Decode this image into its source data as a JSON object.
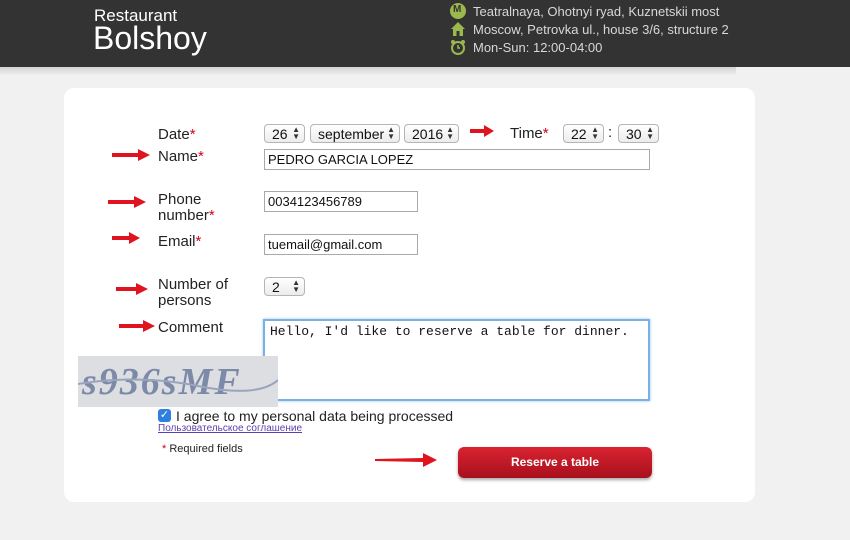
{
  "header": {
    "brand_small": "Restaurant",
    "brand_big": "Bolshoy",
    "metro": "Teatralnaya, Ohotnyi ryad, Kuznetskii most",
    "address": "Moscow, Petrovka ul., house 3/6, structure 2",
    "hours": "Mon-Sun: 12:00-04:00"
  },
  "form": {
    "date_label": "Date",
    "date_day": "26",
    "date_month": "september",
    "date_year": "2016",
    "time_label": "Time",
    "time_hour": "22",
    "time_separator": ":",
    "time_minute": "30",
    "name_label": "Name",
    "name_value": "PEDRO GARCIA LOPEZ",
    "phone_label_line1": "Phone",
    "phone_label_line2": "number",
    "phone_value": "0034123456789",
    "email_label": "Email",
    "email_value": "tuemail@gmail.com",
    "persons_label_line1": "Number of",
    "persons_label_line2": "persons",
    "persons_value": "2",
    "comment_label": "Comment",
    "comment_value": "Hello,  I'd like to reserve a table for dinner.",
    "captcha_text": "s936sMF",
    "agree_text": "I agree to my personal data being processed",
    "agreement_link": "Пользовательское соглашение",
    "required_note": "Required fields",
    "required_mark": "*",
    "reserve_button": "Reserve a table"
  },
  "colors": {
    "header_bg": "#333333",
    "accent_red": "#d0021b",
    "button_red": "#c41a27",
    "focus_blue": "#7ab0e6"
  }
}
